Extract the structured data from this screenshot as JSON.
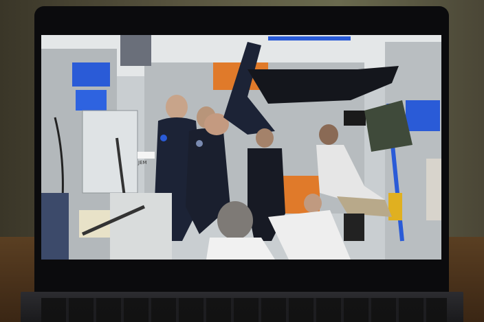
{
  "scene": {
    "labels": {
      "module_label": "JEM"
    },
    "colors": {
      "flightsuit": "#1c2336",
      "screen_bg": "#cfd3d6",
      "accent_blue": "#2a5bd7",
      "accent_orange": "#e07a2a"
    }
  }
}
